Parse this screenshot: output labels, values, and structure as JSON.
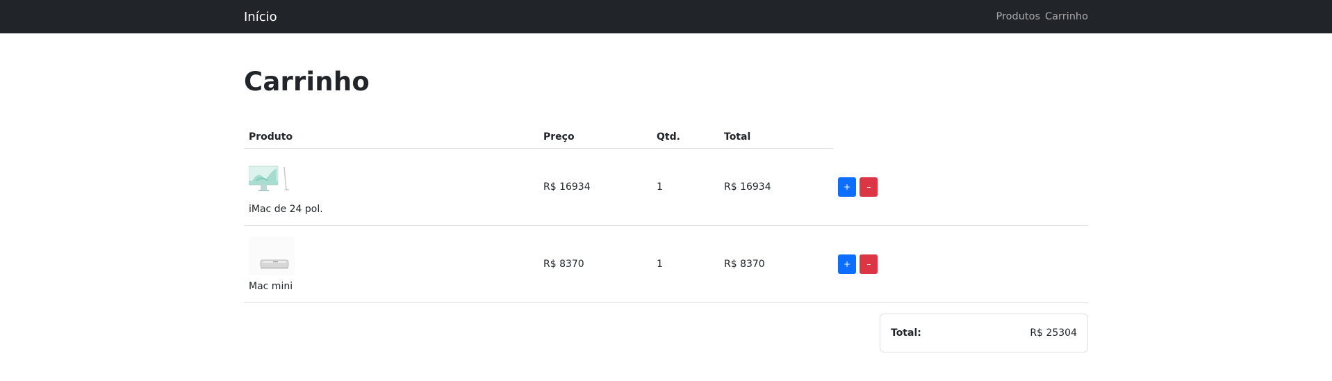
{
  "navbar": {
    "brand": "Início",
    "links": [
      "Produtos",
      "Carrinho"
    ]
  },
  "page": {
    "title": "Carrinho"
  },
  "table": {
    "headers": [
      "Produto",
      "Preço",
      "Qtd.",
      "Total"
    ],
    "rows": [
      {
        "name": "iMac de 24 pol.",
        "price": "R$ 16934",
        "qty": "1",
        "total": "R$ 16934",
        "plus": "+",
        "minus": "–",
        "image": "imac-thumbnail"
      },
      {
        "name": "Mac mini",
        "price": "R$ 8370",
        "qty": "1",
        "total": "R$ 8370",
        "plus": "+",
        "minus": "–",
        "image": "mac-mini-thumbnail"
      }
    ]
  },
  "summary": {
    "label": "Total:",
    "value": "R$ 25304"
  },
  "colors": {
    "navbar": "#212529",
    "primary": "#0d6efd",
    "danger": "#dc3545",
    "border": "#dee2e6"
  }
}
